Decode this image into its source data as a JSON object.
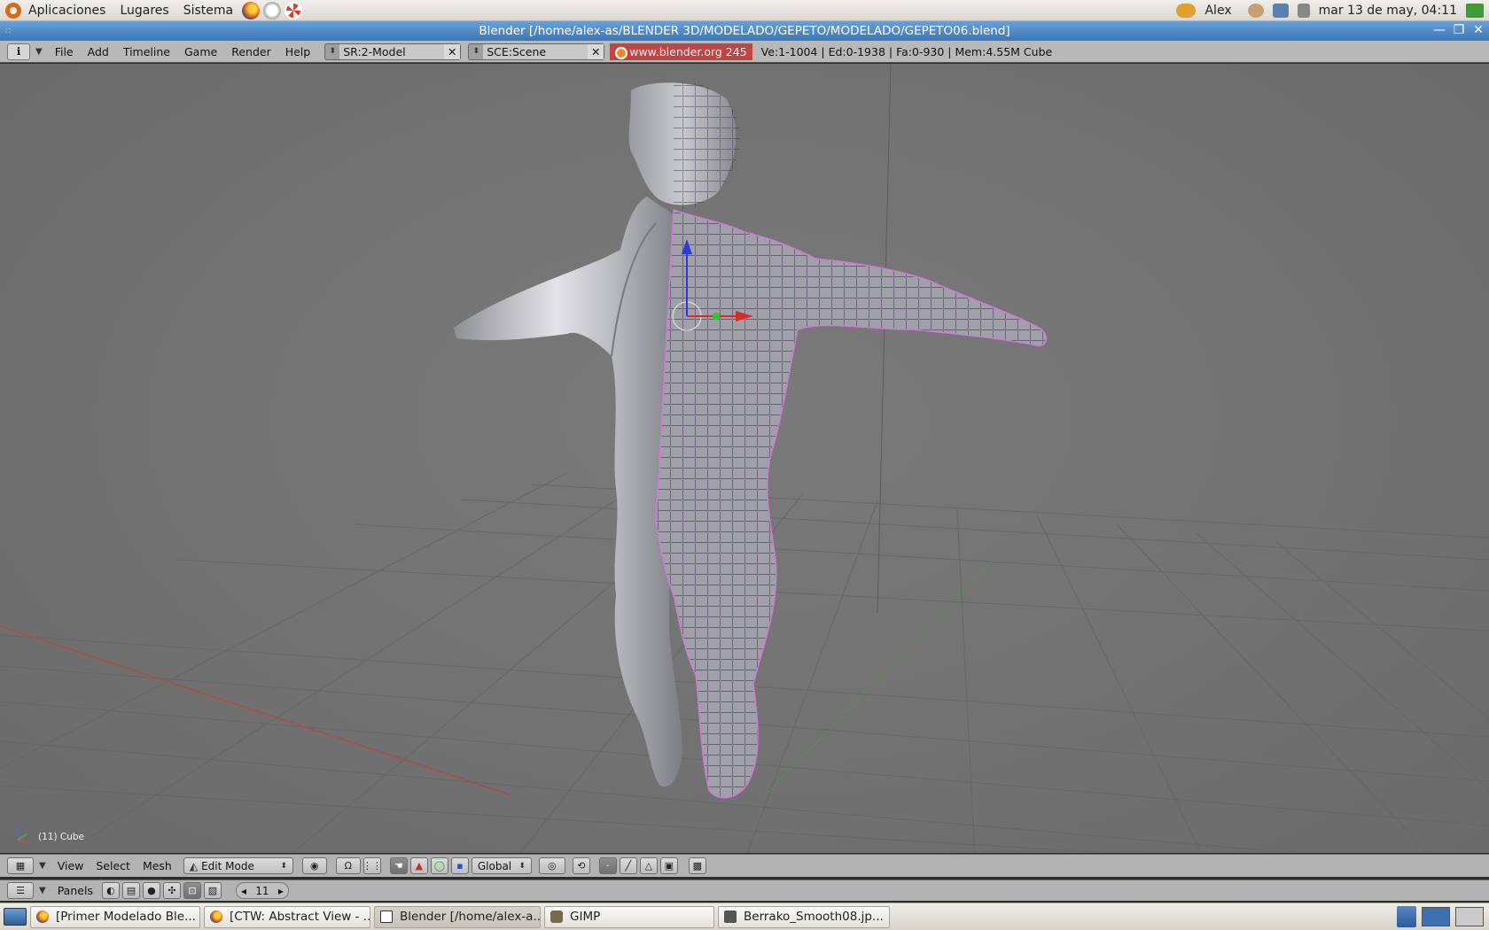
{
  "top_panel": {
    "menus": [
      "Aplicaciones",
      "Lugares",
      "Sistema"
    ],
    "launchers": [
      "firefox-icon",
      "mail-icon",
      "help-icon"
    ],
    "user": "Alex",
    "clock": "mar 13 de may, 04:11"
  },
  "window": {
    "title": "Blender [/home/alex-as/BLENDER 3D/MODELADO/GEPETO/MODELADO/GEPETO06.blend]"
  },
  "info_header": {
    "menus": [
      "File",
      "Add",
      "Timeline",
      "Game",
      "Render",
      "Help"
    ],
    "screen": "SR:2-Model",
    "scene": "SCE:Scene",
    "link": "www.blender.org 245",
    "stats": "Ve:1-1004 | Ed:0-1938 | Fa:0-930 | Mem:4.55M Cube"
  },
  "viewport": {
    "object_label": "(11) Cube",
    "background_color": "#727272",
    "wire_color": "#c77cd0"
  },
  "view_header": {
    "menus": [
      "View",
      "Select",
      "Mesh"
    ],
    "mode": "Edit Mode",
    "orientation": "Global"
  },
  "buttons_header": {
    "panels_label": "Panels",
    "frame": "11"
  },
  "taskbar": {
    "tasks": [
      {
        "label": "[Primer Modelado Ble..."
      },
      {
        "label": "[CTW: Abstract View - ..."
      },
      {
        "label": "Blender [/home/alex-a..."
      },
      {
        "label": "GIMP"
      },
      {
        "label": "Berrako_Smooth08.jp..."
      }
    ]
  }
}
